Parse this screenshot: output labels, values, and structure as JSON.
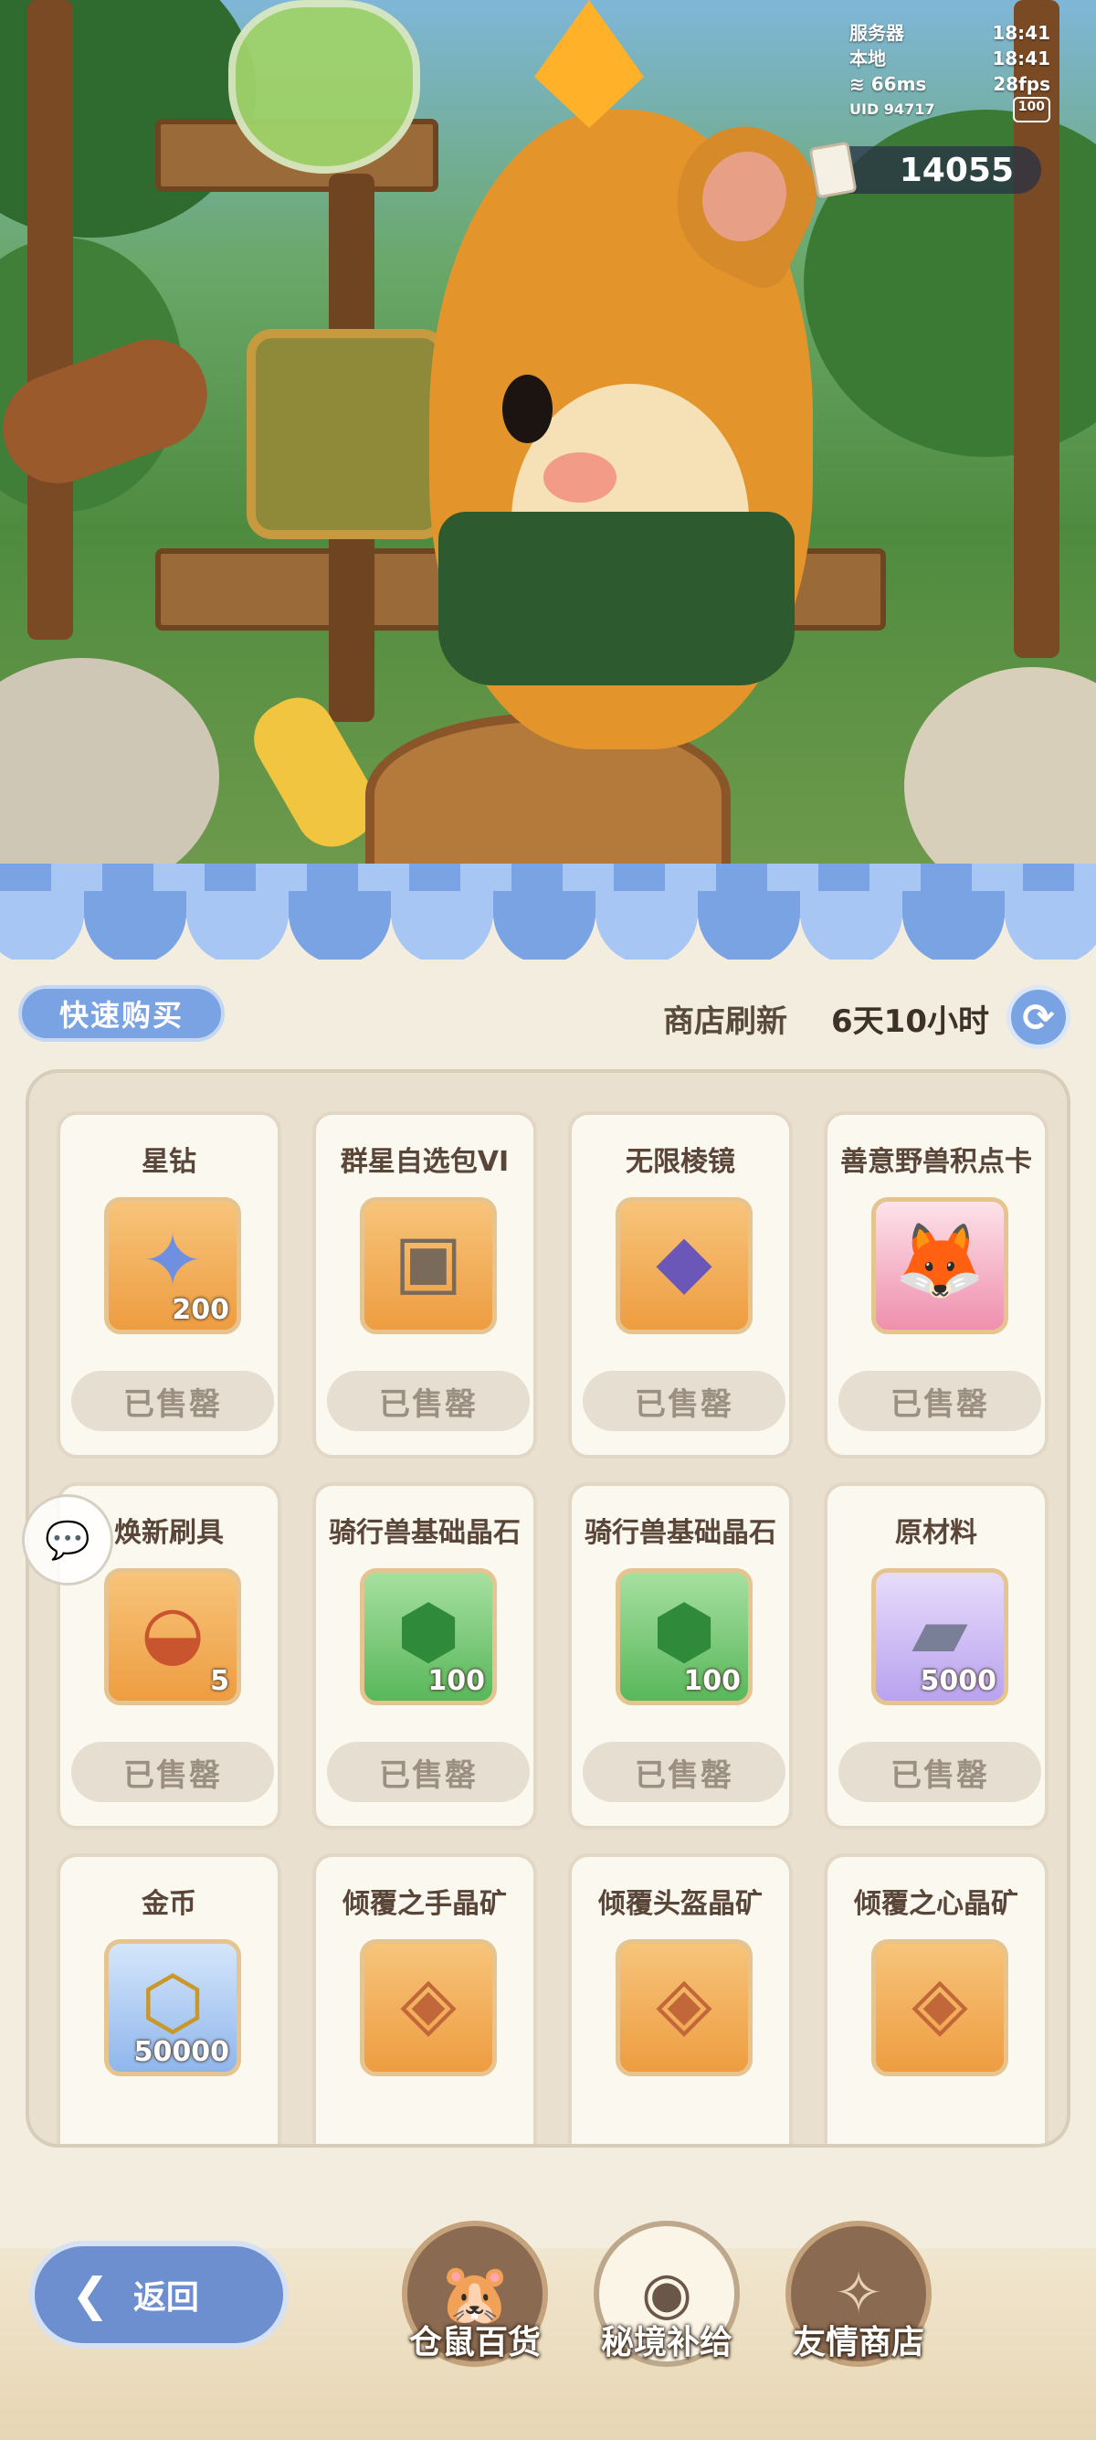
{
  "hud": {
    "server_label": "服务器",
    "server_time": "18:41",
    "local_label": "本地",
    "local_time": "18:41",
    "ping": "66ms",
    "fps": "28fps",
    "uid": "UID 94717",
    "quality_badge": "100"
  },
  "currency": {
    "amount": "14055",
    "icon": "ticket-icon"
  },
  "shop": {
    "quick_buy_label": "快速购买",
    "refresh_label": "商店刷新",
    "refresh_time": "6天10小时",
    "refresh_icon": "refresh-icon"
  },
  "items": [
    {
      "name": "星钻",
      "qty": "200",
      "icon": "star-diamond-icon",
      "bg": "orange",
      "status": "已售罄"
    },
    {
      "name": "群星自选包VI",
      "qty": "",
      "icon": "card-pack-icon",
      "bg": "orange",
      "status": "已售罄"
    },
    {
      "name": "无限棱镜",
      "qty": "",
      "icon": "prism-icon",
      "bg": "orange",
      "status": "已售罄"
    },
    {
      "name": "善意野兽积点卡",
      "qty": "",
      "icon": "beast-card-icon",
      "bg": "pink",
      "status": "已售罄"
    },
    {
      "name": "焕新刷具",
      "qty": "5",
      "icon": "brush-icon",
      "bg": "orange",
      "status": "已售罄"
    },
    {
      "name": "骑行兽基础晶石",
      "qty": "100",
      "icon": "green-crystal-icon",
      "bg": "green",
      "status": "已售罄"
    },
    {
      "name": "骑行兽基础晶石",
      "qty": "100",
      "icon": "green-crystal-icon",
      "bg": "green",
      "status": "已售罄"
    },
    {
      "name": "原材料",
      "qty": "5000",
      "icon": "ingot-icon",
      "bg": "purple",
      "status": "已售罄"
    },
    {
      "name": "金币",
      "qty": "50000",
      "icon": "gold-coin-icon",
      "bg": "blue",
      "status": ""
    },
    {
      "name": "倾覆之手晶矿",
      "qty": "",
      "icon": "ore-icon",
      "bg": "orange",
      "status": ""
    },
    {
      "name": "倾覆头盔晶矿",
      "qty": "",
      "icon": "ore-icon",
      "bg": "orange",
      "status": ""
    },
    {
      "name": "倾覆之心晶矿",
      "qty": "",
      "icon": "ore-icon",
      "bg": "orange",
      "status": ""
    }
  ],
  "nav": {
    "back_label": "返回",
    "tabs": [
      {
        "label": "仓鼠百货",
        "icon": "hamster-icon",
        "active": false
      },
      {
        "label": "秘境补给",
        "icon": "eye-emblem-icon",
        "active": true
      },
      {
        "label": "友情商店",
        "icon": "crystal-ball-icon",
        "active": false
      }
    ]
  }
}
